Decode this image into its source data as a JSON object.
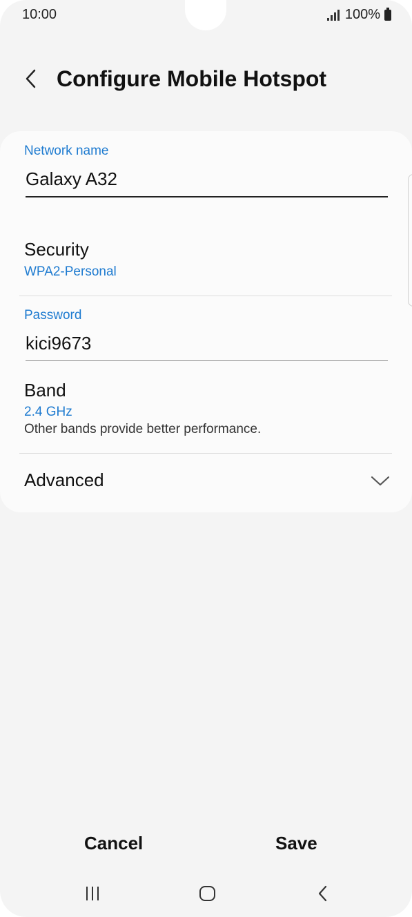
{
  "status_bar": {
    "time": "10:00",
    "battery": "100%"
  },
  "header": {
    "title": "Configure Mobile Hotspot"
  },
  "form": {
    "network_name": {
      "label": "Network name",
      "value": "Galaxy A32"
    },
    "security": {
      "title": "Security",
      "value": "WPA2-Personal"
    },
    "password": {
      "label": "Password",
      "value": "kici9673"
    },
    "band": {
      "title": "Band",
      "value": "2.4 GHz",
      "description": "Other bands provide better performance."
    },
    "advanced": {
      "title": "Advanced"
    }
  },
  "actions": {
    "cancel_label": "Cancel",
    "save_label": "Save"
  },
  "colors": {
    "accent": "#1e7bd0",
    "background": "#f4f4f4",
    "card": "#fbfbfb"
  }
}
